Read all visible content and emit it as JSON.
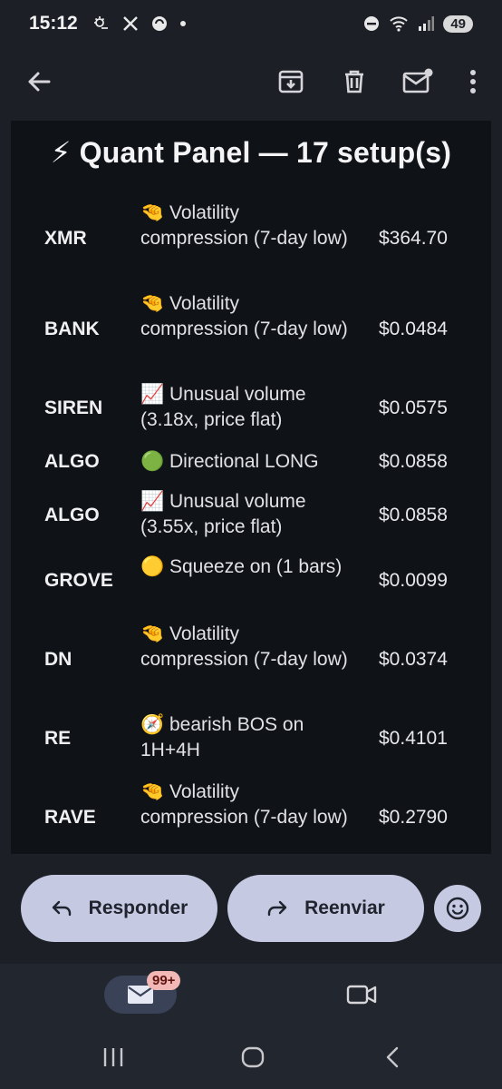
{
  "status_bar": {
    "time": "15:12",
    "battery": "49"
  },
  "app_bar": {
    "back_icon": "arrow-left-icon",
    "archive_icon": "archive-icon",
    "delete_icon": "trash-icon",
    "unread_icon": "mark-unread-icon",
    "more_icon": "more-vert-icon"
  },
  "email": {
    "title": "⚡ Quant Panel — 17 setup(s)",
    "rows": [
      {
        "symbol": "XMR",
        "emoji": "🤏",
        "text": "Volatility compression (7-day low)",
        "price": "$364.70"
      },
      {
        "symbol": "BANK",
        "emoji": "🤏",
        "text": "Volatility compression (7-day low)",
        "price": "$0.0484"
      },
      {
        "symbol": "SIREN",
        "emoji": "📈",
        "text": "Unusual volume (3.18x, price flat)",
        "price": "$0.0575"
      },
      {
        "symbol": "ALGO",
        "emoji": "🟢",
        "text": "Directional LONG",
        "price": "$0.0858"
      },
      {
        "symbol": "ALGO",
        "emoji": "📈",
        "text": "Unusual volume (3.55x, price flat)",
        "price": "$0.0858"
      },
      {
        "symbol": "GROVE",
        "emoji": "🟡",
        "text": "Squeeze on (1 bars)",
        "price": "$0.0099"
      },
      {
        "symbol": "DN",
        "emoji": "🤏",
        "text": "Volatility compression (7-day low)",
        "price": "$0.0374"
      },
      {
        "symbol": "RE",
        "emoji": "🧭",
        "text": "bearish BOS on 1H+4H",
        "price": "$0.4101"
      },
      {
        "symbol": "RAVE",
        "emoji": "🤏",
        "text": "Volatility compression (7-day low)",
        "price": "$0.2790"
      }
    ]
  },
  "actions": {
    "reply_label": "Responder",
    "forward_label": "Reenviar"
  },
  "bottom_nav": {
    "mail_badge": "99+"
  },
  "colors": {
    "background": "#1c1f26",
    "panel": "#0f1216",
    "button": "#c5cae2"
  }
}
